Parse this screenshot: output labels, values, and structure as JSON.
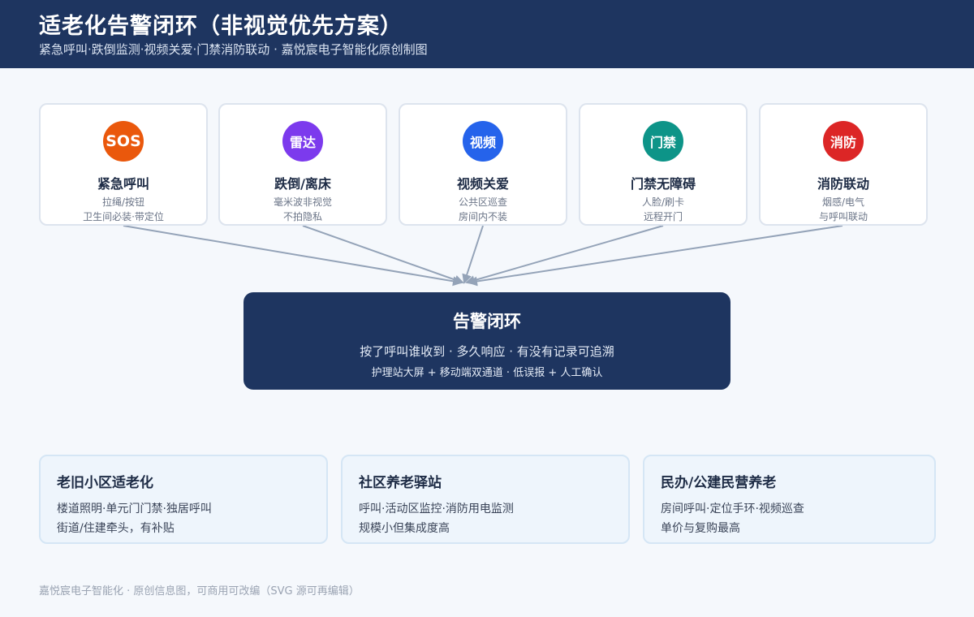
{
  "header": {
    "title": "适老化告警闭环（非视觉优先方案）",
    "subtitle": "紧急呼叫·跌倒监测·视频关爱·门禁消防联动 · 嘉悦宸电子智能化原创制图"
  },
  "sources": [
    {
      "badge": "SOS",
      "badge_color": "#ea580c",
      "icon": "sos-icon",
      "title": "紧急呼叫",
      "desc1": "拉绳/按钮",
      "desc2": "卫生间必装·带定位"
    },
    {
      "badge": "雷达",
      "badge_color": "#7c3aed",
      "icon": "radar-icon",
      "title": "跌倒/离床",
      "desc1": "毫米波非视觉",
      "desc2": "不拍隐私"
    },
    {
      "badge": "视频",
      "badge_color": "#2563eb",
      "icon": "video-icon",
      "title": "视频关爱",
      "desc1": "公共区巡查",
      "desc2": "房间内不装"
    },
    {
      "badge": "门禁",
      "badge_color": "#0d9488",
      "icon": "access-icon",
      "title": "门禁无障碍",
      "desc1": "人脸/刷卡",
      "desc2": "远程开门"
    },
    {
      "badge": "消防",
      "badge_color": "#dc2626",
      "icon": "fire-icon",
      "title": "消防联动",
      "desc1": "烟感/电气",
      "desc2": "与呼叫联动"
    }
  ],
  "hub": {
    "title": "告警闭环",
    "line1": "按了呼叫谁收到 · 多久响应 · 有没有记录可追溯",
    "line2": "护理站大屏 + 移动端双通道 · 低误报 + 人工确认"
  },
  "scenarios": [
    {
      "title": "老旧小区适老化",
      "line1": "楼道照明·单元门门禁·独居呼叫",
      "line2": "街道/住建牵头，有补贴"
    },
    {
      "title": "社区养老驿站",
      "line1": "呼叫·活动区监控·消防用电监测",
      "line2": "规模小但集成度高"
    },
    {
      "title": "民办/公建民营养老",
      "line1": "房间呼叫·定位手环·视频巡查",
      "line2": "单价与复购最高"
    }
  ],
  "footer": "嘉悦宸电子智能化 · 原创信息图，可商用可改编（SVG 源可再编辑）",
  "colors": {
    "header_bg": "#1e3560",
    "arrow": "#94a3b8"
  }
}
